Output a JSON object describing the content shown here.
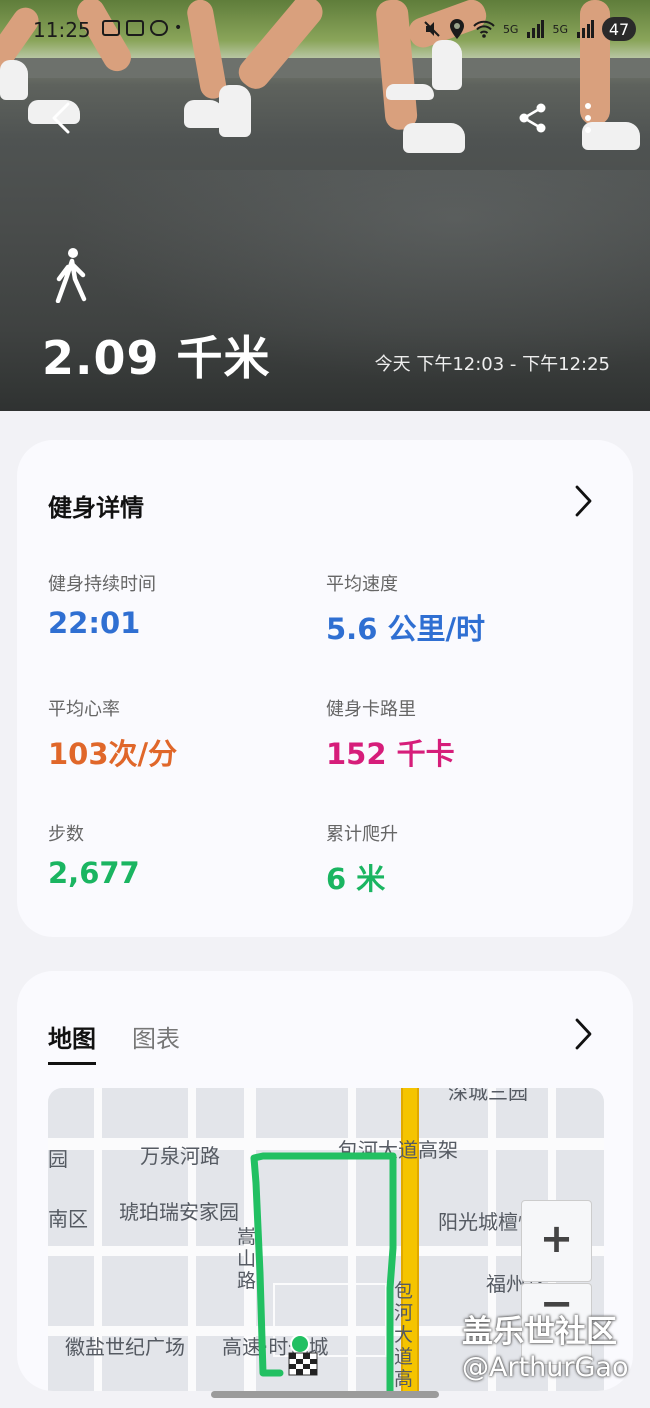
{
  "status_bar": {
    "time": "11:25",
    "network_1": "5G",
    "network_2": "5G",
    "battery": "47"
  },
  "hero": {
    "distance": "2.09 千米",
    "time_range": "今天 下午12:03 - 下午12:25"
  },
  "details": {
    "title": "健身详情",
    "metrics": [
      {
        "label": "健身持续时间",
        "value": "22:01",
        "color": "#2f6fd2"
      },
      {
        "label": "平均速度",
        "value": "5.6 公里/时",
        "color": "#2f6fd2"
      },
      {
        "label": "平均心率",
        "value": "103次/分",
        "color": "#e0672a"
      },
      {
        "label": "健身卡路里",
        "value": "152 千卡",
        "color": "#d61d7a"
      },
      {
        "label": "步数",
        "value": "2,677",
        "color": "#1ab561"
      },
      {
        "label": "累计爬升",
        "value": "6 米",
        "color": "#1ab561"
      }
    ]
  },
  "map_card": {
    "tabs": [
      {
        "label": "地图"
      },
      {
        "label": "图表"
      }
    ],
    "map_labels": {
      "top_cut": "深城三园",
      "yuan": "园",
      "wanquan": "万泉河路",
      "baohe": "包河大道高架",
      "nanqu": "南区",
      "hupo": "琥珀瑞安家园",
      "yangguang": "阳光城檀悦",
      "fuzhou": "福州路",
      "huiyan": "徽盐世纪广场",
      "gaosu": "高速·时代城",
      "v_road": "嵩山路",
      "v_baohe": "包河大道高"
    },
    "zoom_in": "+",
    "zoom_out": "−",
    "route_color": "#22c062"
  },
  "watermark": {
    "line1": "盖乐世社区",
    "line2": "@ArthurGao"
  }
}
